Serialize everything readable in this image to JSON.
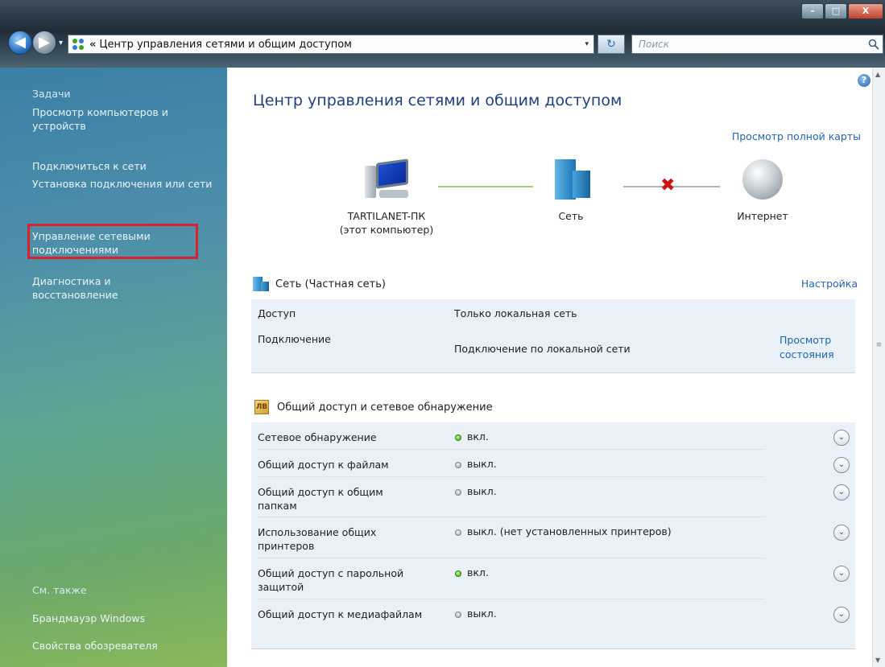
{
  "window": {
    "minimize": "–",
    "maximize": "□",
    "close": "X"
  },
  "nav": {
    "back": "◀",
    "forward": "▶",
    "dropdown": "▾"
  },
  "address": {
    "separator": "«",
    "path": "Центр управления сетями и общим доступом",
    "dropdown": "▾",
    "refresh": "↻"
  },
  "search": {
    "placeholder": "Поиск",
    "icon": "search-icon"
  },
  "sidebar": {
    "tasks_heading": "Задачи",
    "items": [
      "Просмотр компьютеров и устройств",
      "Подключиться к сети",
      "Установка подключения или сети",
      "Управление сетевыми подключениями",
      "Диагностика и восстановление"
    ],
    "see_also_heading": "См. также",
    "see_also": [
      "Брандмауэр Windows",
      "Свойства обозревателя"
    ]
  },
  "main": {
    "help": "?",
    "title": "Центр управления сетями и общим доступом",
    "full_map_link": "Просмотр полной карты",
    "map": {
      "computer_name": "TARTILANET-ПК",
      "computer_sub": "(этот компьютер)",
      "network": "Сеть",
      "internet": "Интернет",
      "x_mark": "✖"
    },
    "network_section": {
      "title": "Сеть (Частная сеть)",
      "configure_link": "Настройка",
      "access_label": "Доступ",
      "access_value": "Только локальная сеть",
      "connection_label": "Подключение",
      "connection_value": "Подключение по локальной сети",
      "view_status_link_1": "Просмотр",
      "view_status_link_2": "состояния"
    },
    "sharing_section": {
      "icon_text": "ЛВ",
      "title": "Общий доступ и сетевое обнаружение",
      "rows": [
        {
          "label": "Сетевое обнаружение",
          "status": "вкл.",
          "on": true
        },
        {
          "label": "Общий доступ к файлам",
          "status": "выкл.",
          "on": false
        },
        {
          "label": "Общий доступ к общим папкам",
          "status": "выкл.",
          "on": false
        },
        {
          "label": "Использование общих принтеров",
          "status": "выкл. (нет установленных принтеров)",
          "on": false
        },
        {
          "label": "Общий доступ с парольной защитой",
          "status": "вкл.",
          "on": true
        },
        {
          "label": "Общий доступ к медиафайлам",
          "status": "выкл.",
          "on": false
        }
      ],
      "expand_glyph": "⌄"
    }
  },
  "colors": {
    "link": "#1e64b4",
    "title": "#1c3f86",
    "highlight": "#d8232a",
    "status_on": "#3aa61a",
    "status_off": "#9aa3a8"
  }
}
